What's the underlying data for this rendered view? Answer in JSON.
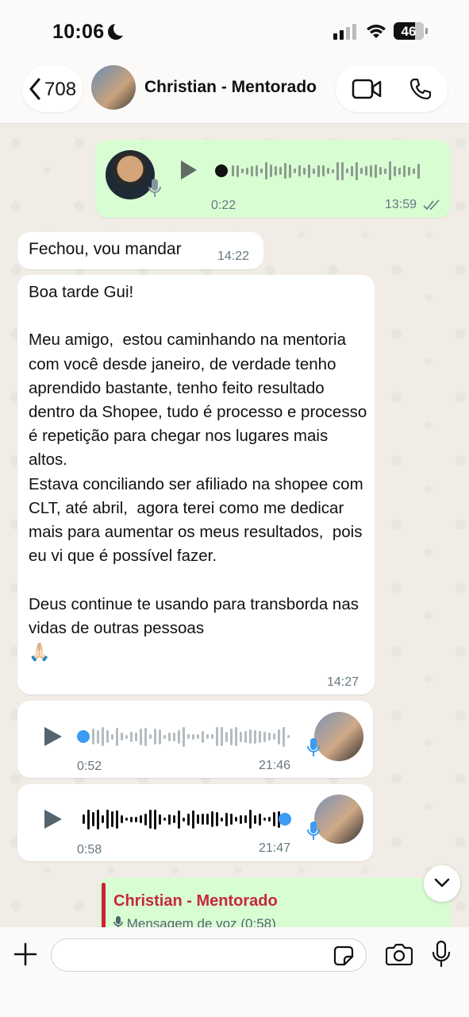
{
  "status_bar": {
    "time": "10:06",
    "battery": "46"
  },
  "header": {
    "back_count": "708",
    "contact_name": "Christian - Mentorado"
  },
  "messages": {
    "voice_out": {
      "duration": "0:22",
      "time": "13:59",
      "status": "read"
    },
    "text_short": {
      "text": "Fechou,  vou mandar",
      "time": "14:22"
    },
    "text_long": {
      "text": "Boa tarde Gui!\n\nMeu amigo,  estou caminhando na mentoria com você desde janeiro, de verdade tenho aprendido bastante, tenho feito resultado dentro da Shopee, tudo é processo e processo é repetição para chegar nos lugares mais altos.\nEstava conciliando ser afiliado na shopee com CLT, até abril,  agora terei como me dedicar mais para aumentar os meus resultados,  pois eu vi que é possível fazer.\n\nDeus continue te usando para transborda nas vidas de outras pessoas",
      "emoji": "🙏🏻",
      "time": "14:27"
    },
    "voice_in_1": {
      "duration": "0:52",
      "time": "21:46",
      "progress": 0
    },
    "voice_in_2": {
      "duration": "0:58",
      "time": "21:47",
      "progress": 1
    }
  },
  "reply_preview": {
    "name": "Christian - Mentorado",
    "subtitle": "Mensagem de voz (0:58)"
  },
  "composer": {
    "placeholder": ""
  },
  "colors": {
    "outgoing_bubble": "#d9fdd3",
    "incoming_bubble": "#ffffff",
    "reply_accent": "#cf1f3a",
    "voice_progress": "#3b9cf1"
  }
}
